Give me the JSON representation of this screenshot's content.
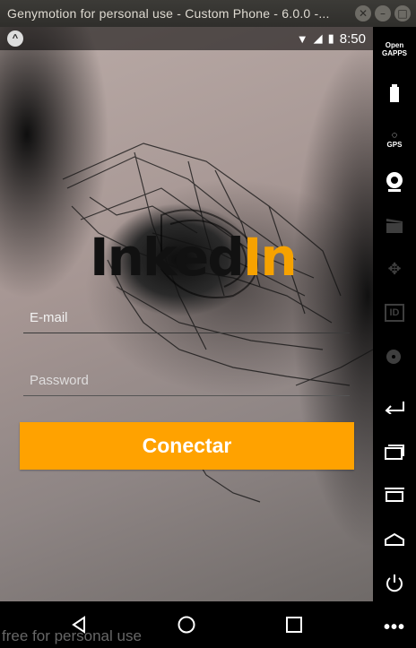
{
  "window": {
    "title": "Genymotion for personal use - Custom Phone - 6.0.0 -...",
    "controls": [
      "close-icon",
      "minimize-icon",
      "maximize-icon"
    ]
  },
  "statusbar": {
    "left_icon": "android-notification-icon",
    "time": "8:50",
    "icons": [
      "wifi-icon",
      "signal-icon",
      "battery-icon"
    ]
  },
  "logo": {
    "part1": "Inked",
    "part2": "In",
    "accent_color": "#f6a200"
  },
  "form": {
    "email_placeholder": "E-mail",
    "password_placeholder": "Password",
    "connect_label": "Conectar",
    "button_color": "#ffa200"
  },
  "sidepanel": {
    "opengapps_label_1": "Open",
    "opengapps_label_2": "GAPPS",
    "gps_label": "GPS",
    "id_label": "ID",
    "items": [
      "opengapps-icon",
      "battery-icon",
      "gps-icon",
      "camera-icon",
      "media-icon",
      "dpad-icon",
      "id-icon",
      "disk-icon",
      "back-icon",
      "recent-apps-icon",
      "menu-icon",
      "home-icon",
      "power-icon",
      "more-icon"
    ]
  },
  "navbar": {
    "buttons": [
      "back-triangle-icon",
      "home-circle-icon",
      "recents-square-icon"
    ]
  },
  "watermark": "free for personal use"
}
